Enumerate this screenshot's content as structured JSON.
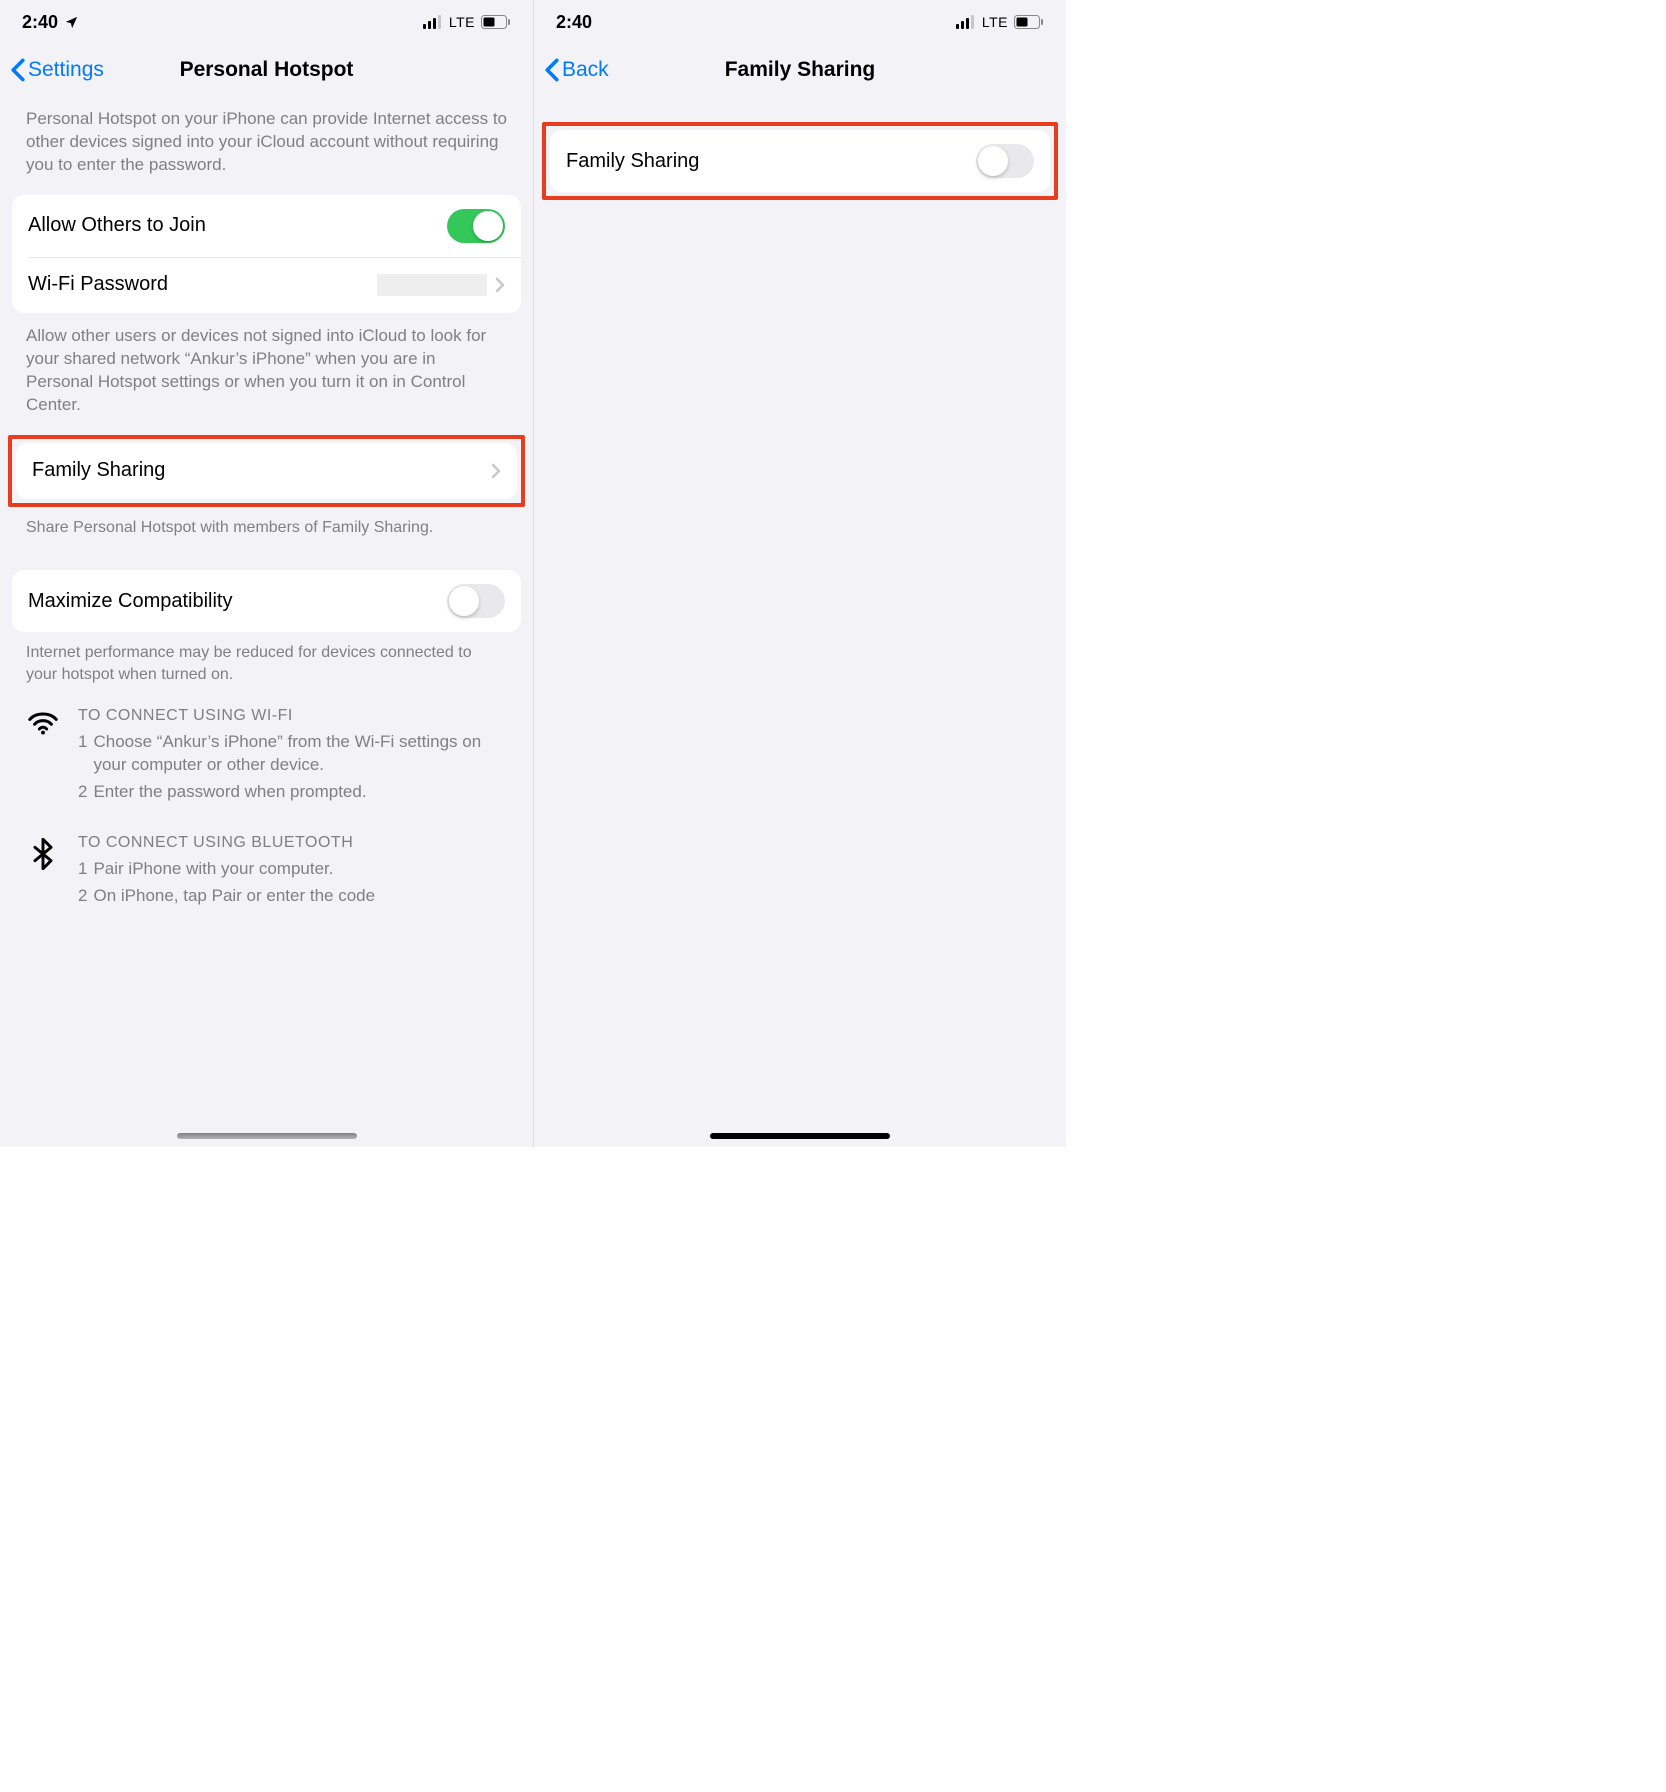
{
  "statusBar": {
    "time": "2:40",
    "network": "LTE"
  },
  "left": {
    "backLabel": "Settings",
    "title": "Personal Hotspot",
    "intro": "Personal Hotspot on your iPhone can provide Internet access to other devices signed into your iCloud account without requiring you to enter the password.",
    "allowOthersLabel": "Allow Others to Join",
    "wifiPasswordLabel": "Wi-Fi Password",
    "allowDesc": "Allow other users or devices not signed into iCloud to look for your shared network “Ankur’s iPhone” when you are in Personal Hotspot settings or when you turn it on in Control Center.",
    "familySharingLabel": "Family Sharing",
    "familySharingDesc": "Share Personal Hotspot with members of Family Sharing.",
    "maximizeLabel": "Maximize Compatibility",
    "maximizeDesc": "Internet performance may be reduced for devices connected to your hotspot when turned on.",
    "wifiInstr": {
      "title": "TO CONNECT USING WI-FI",
      "step1": "Choose “Ankur’s iPhone” from the Wi-Fi settings on your computer or other device.",
      "step2": "Enter the password when prompted."
    },
    "btInstr": {
      "title": "TO CONNECT USING BLUETOOTH",
      "step1": "Pair iPhone with your computer.",
      "step2": "On iPhone, tap Pair or enter the code"
    }
  },
  "right": {
    "backLabel": "Back",
    "title": "Family Sharing",
    "rowLabel": "Family Sharing"
  }
}
